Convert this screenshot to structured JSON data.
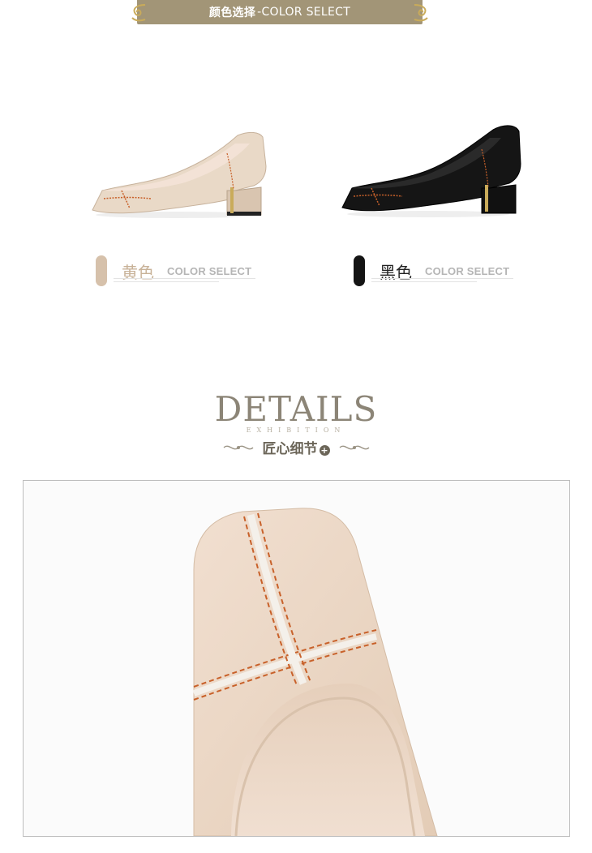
{
  "banner": {
    "zh": "颜色选择",
    "en": "-COLOR SELECT"
  },
  "colors": [
    {
      "name": "黄色",
      "select": "COLOR SELECT",
      "swatch": "#d6c1ab"
    },
    {
      "name": "黑色",
      "select": "COLOR SELECT",
      "swatch": "#141414"
    }
  ],
  "details": {
    "title": "DETAILS",
    "subtitle": "EXHIBITION",
    "label": "匠心细节",
    "plus": "+"
  },
  "palette": {
    "accent": "#a29577",
    "beige": "#e8d6c4",
    "stitch": "#c8612a"
  }
}
